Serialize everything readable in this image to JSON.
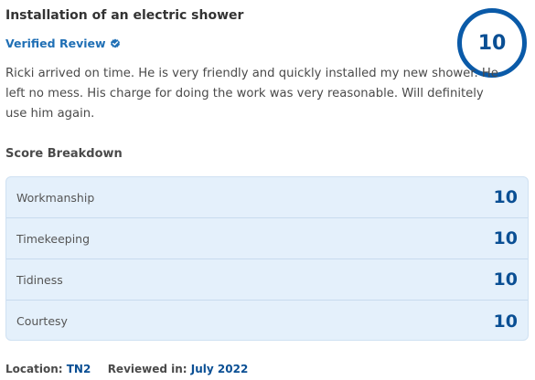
{
  "review": {
    "title": "Installation of an electric shower",
    "verified_label": "Verified Review",
    "overall_score": "10",
    "body": "Ricki arrived on time. He is very friendly and quickly installed my new shower. He left no mess. His charge for doing the work was very reasonable. Will definitely use him again.",
    "breakdown_title": "Score Breakdown",
    "breakdown": [
      {
        "label": "Workmanship",
        "score": "10"
      },
      {
        "label": "Timekeeping",
        "score": "10"
      },
      {
        "label": "Tidiness",
        "score": "10"
      },
      {
        "label": "Courtesy",
        "score": "10"
      }
    ],
    "location_label": "Location:",
    "location_value": "TN2",
    "reviewed_label": "Reviewed in:",
    "reviewed_value": "July 2022"
  },
  "icons": {
    "verified": "verified-check-icon"
  },
  "colors": {
    "accent": "#0a4f94",
    "verified": "#1f6fb5",
    "breakdown_bg": "#e4f0fb"
  }
}
